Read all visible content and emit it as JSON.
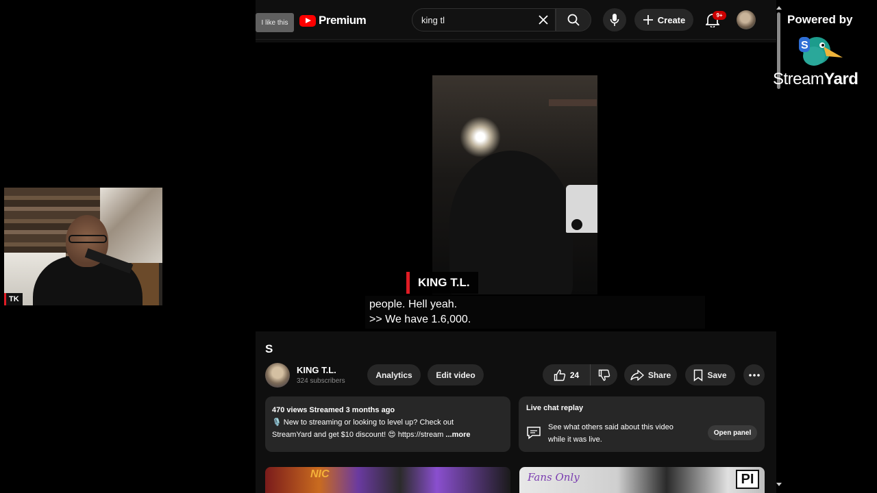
{
  "header": {
    "tooltip": "I like this",
    "logo_text": "Premium",
    "search_value": "king tl",
    "create_label": "Create",
    "notification_count": "9+"
  },
  "player": {
    "speaker_name": "KING T.L.",
    "caption_line1": "people. Hell yeah.",
    "caption_line2": ">> We have 1.6,000."
  },
  "video": {
    "title": "S",
    "channel_name": "KING T.L.",
    "subscribers": "324 subscribers",
    "analytics_label": "Analytics",
    "edit_label": "Edit video",
    "like_count": "24",
    "share_label": "Share",
    "save_label": "Save"
  },
  "description": {
    "stats": "470 views  Streamed 3 months ago",
    "line1": "🎙️ New to streaming or looking to level up? Check out",
    "line2": "StreamYard and get $10 discount! 😍 https://stream",
    "more": "...more"
  },
  "live_chat": {
    "title": "Live chat replay",
    "line1": "See what others said about this video",
    "line2": "while it was live.",
    "open_label": "Open panel"
  },
  "thumbnails": {
    "left_label": "NIC",
    "right_label": "Fans Only",
    "right_badge": "PI"
  },
  "webcam": {
    "name_tag": "TK"
  },
  "branding": {
    "powered_by": "Powered by",
    "brand_part1": "Stream",
    "brand_part2": "Yard"
  },
  "colors": {
    "accent_red": "#e01b24",
    "youtube_red": "#ff0000",
    "chip_bg": "#272727",
    "page_bg": "#0f0f0f"
  }
}
